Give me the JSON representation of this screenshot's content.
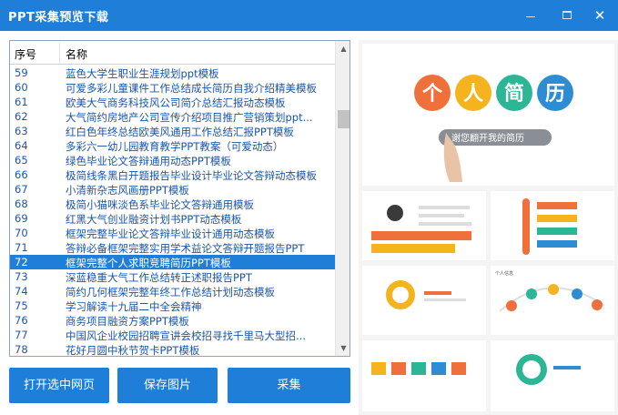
{
  "window": {
    "title": "PPT采集预览下载",
    "minimize_icon": "minimize-icon",
    "maximize_icon": "maximize-icon",
    "close_icon": "close-icon"
  },
  "list": {
    "columns": {
      "no": "序号",
      "name": "名称"
    },
    "selected_index": 13,
    "rows": [
      {
        "no": "59",
        "name": "蓝色大学生职业生涯规划ppt模板"
      },
      {
        "no": "60",
        "name": "可爱多彩儿童课件工作总结成长简历自我介绍精美模板"
      },
      {
        "no": "61",
        "name": "欧美大气商务科技风公司简介总结汇报动态模板"
      },
      {
        "no": "62",
        "name": "大气简约房地产公司宣传介绍项目推广营销策划ppt..."
      },
      {
        "no": "63",
        "name": "红白色年终总结欧美风通用工作总结汇报PPT模板"
      },
      {
        "no": "64",
        "name": "多彩六一幼儿园教育教学PPT教案（可爱动态）"
      },
      {
        "no": "65",
        "name": "绿色毕业论文答辩通用动态PPT模板"
      },
      {
        "no": "66",
        "name": "极简线条黑白开题报告毕业设计毕业论文答辩动态模板"
      },
      {
        "no": "67",
        "name": "小清新杂志风画册PPT模板"
      },
      {
        "no": "68",
        "name": "极简小猫咪淡色系毕业论文答辩通用模板"
      },
      {
        "no": "69",
        "name": "红黑大气创业融资计划书PPT动态模板"
      },
      {
        "no": "70",
        "name": "框架完整毕业论文答辩毕业设计通用动态模板"
      },
      {
        "no": "71",
        "name": "答辩必备框架完整实用学术益论文答辩开题报告PPT"
      },
      {
        "no": "72",
        "name": "框架完整个人求职竞聘简历PPT模板"
      },
      {
        "no": "73",
        "name": "深蓝稳重大气工作总结转正述职报告PPT"
      },
      {
        "no": "74",
        "name": "简约几何框架完整年终工作总结计划动态模板"
      },
      {
        "no": "75",
        "name": "学习解读十九届二中全会精神"
      },
      {
        "no": "76",
        "name": "商务项目融资方案PPT模板"
      },
      {
        "no": "77",
        "name": "中国风企业校园招聘宣讲会校招寻找千里马大型招..."
      },
      {
        "no": "78",
        "name": "花好月圆中秋节贺卡PPT模板"
      }
    ]
  },
  "buttons": {
    "open_page": "打开选中网页",
    "save_image": "保存图片",
    "collect": "采集"
  },
  "preview": {
    "cover_chars": [
      "个",
      "人",
      "简",
      "历"
    ],
    "cover_subtitle": "谢您翻开我的简历",
    "slide_label": "个人信息",
    "colors": {
      "orange": "#f0703c",
      "yellow": "#f5b41e",
      "green": "#2db696",
      "blue": "#2d8cd2",
      "accent": "#1f7fd8"
    }
  }
}
